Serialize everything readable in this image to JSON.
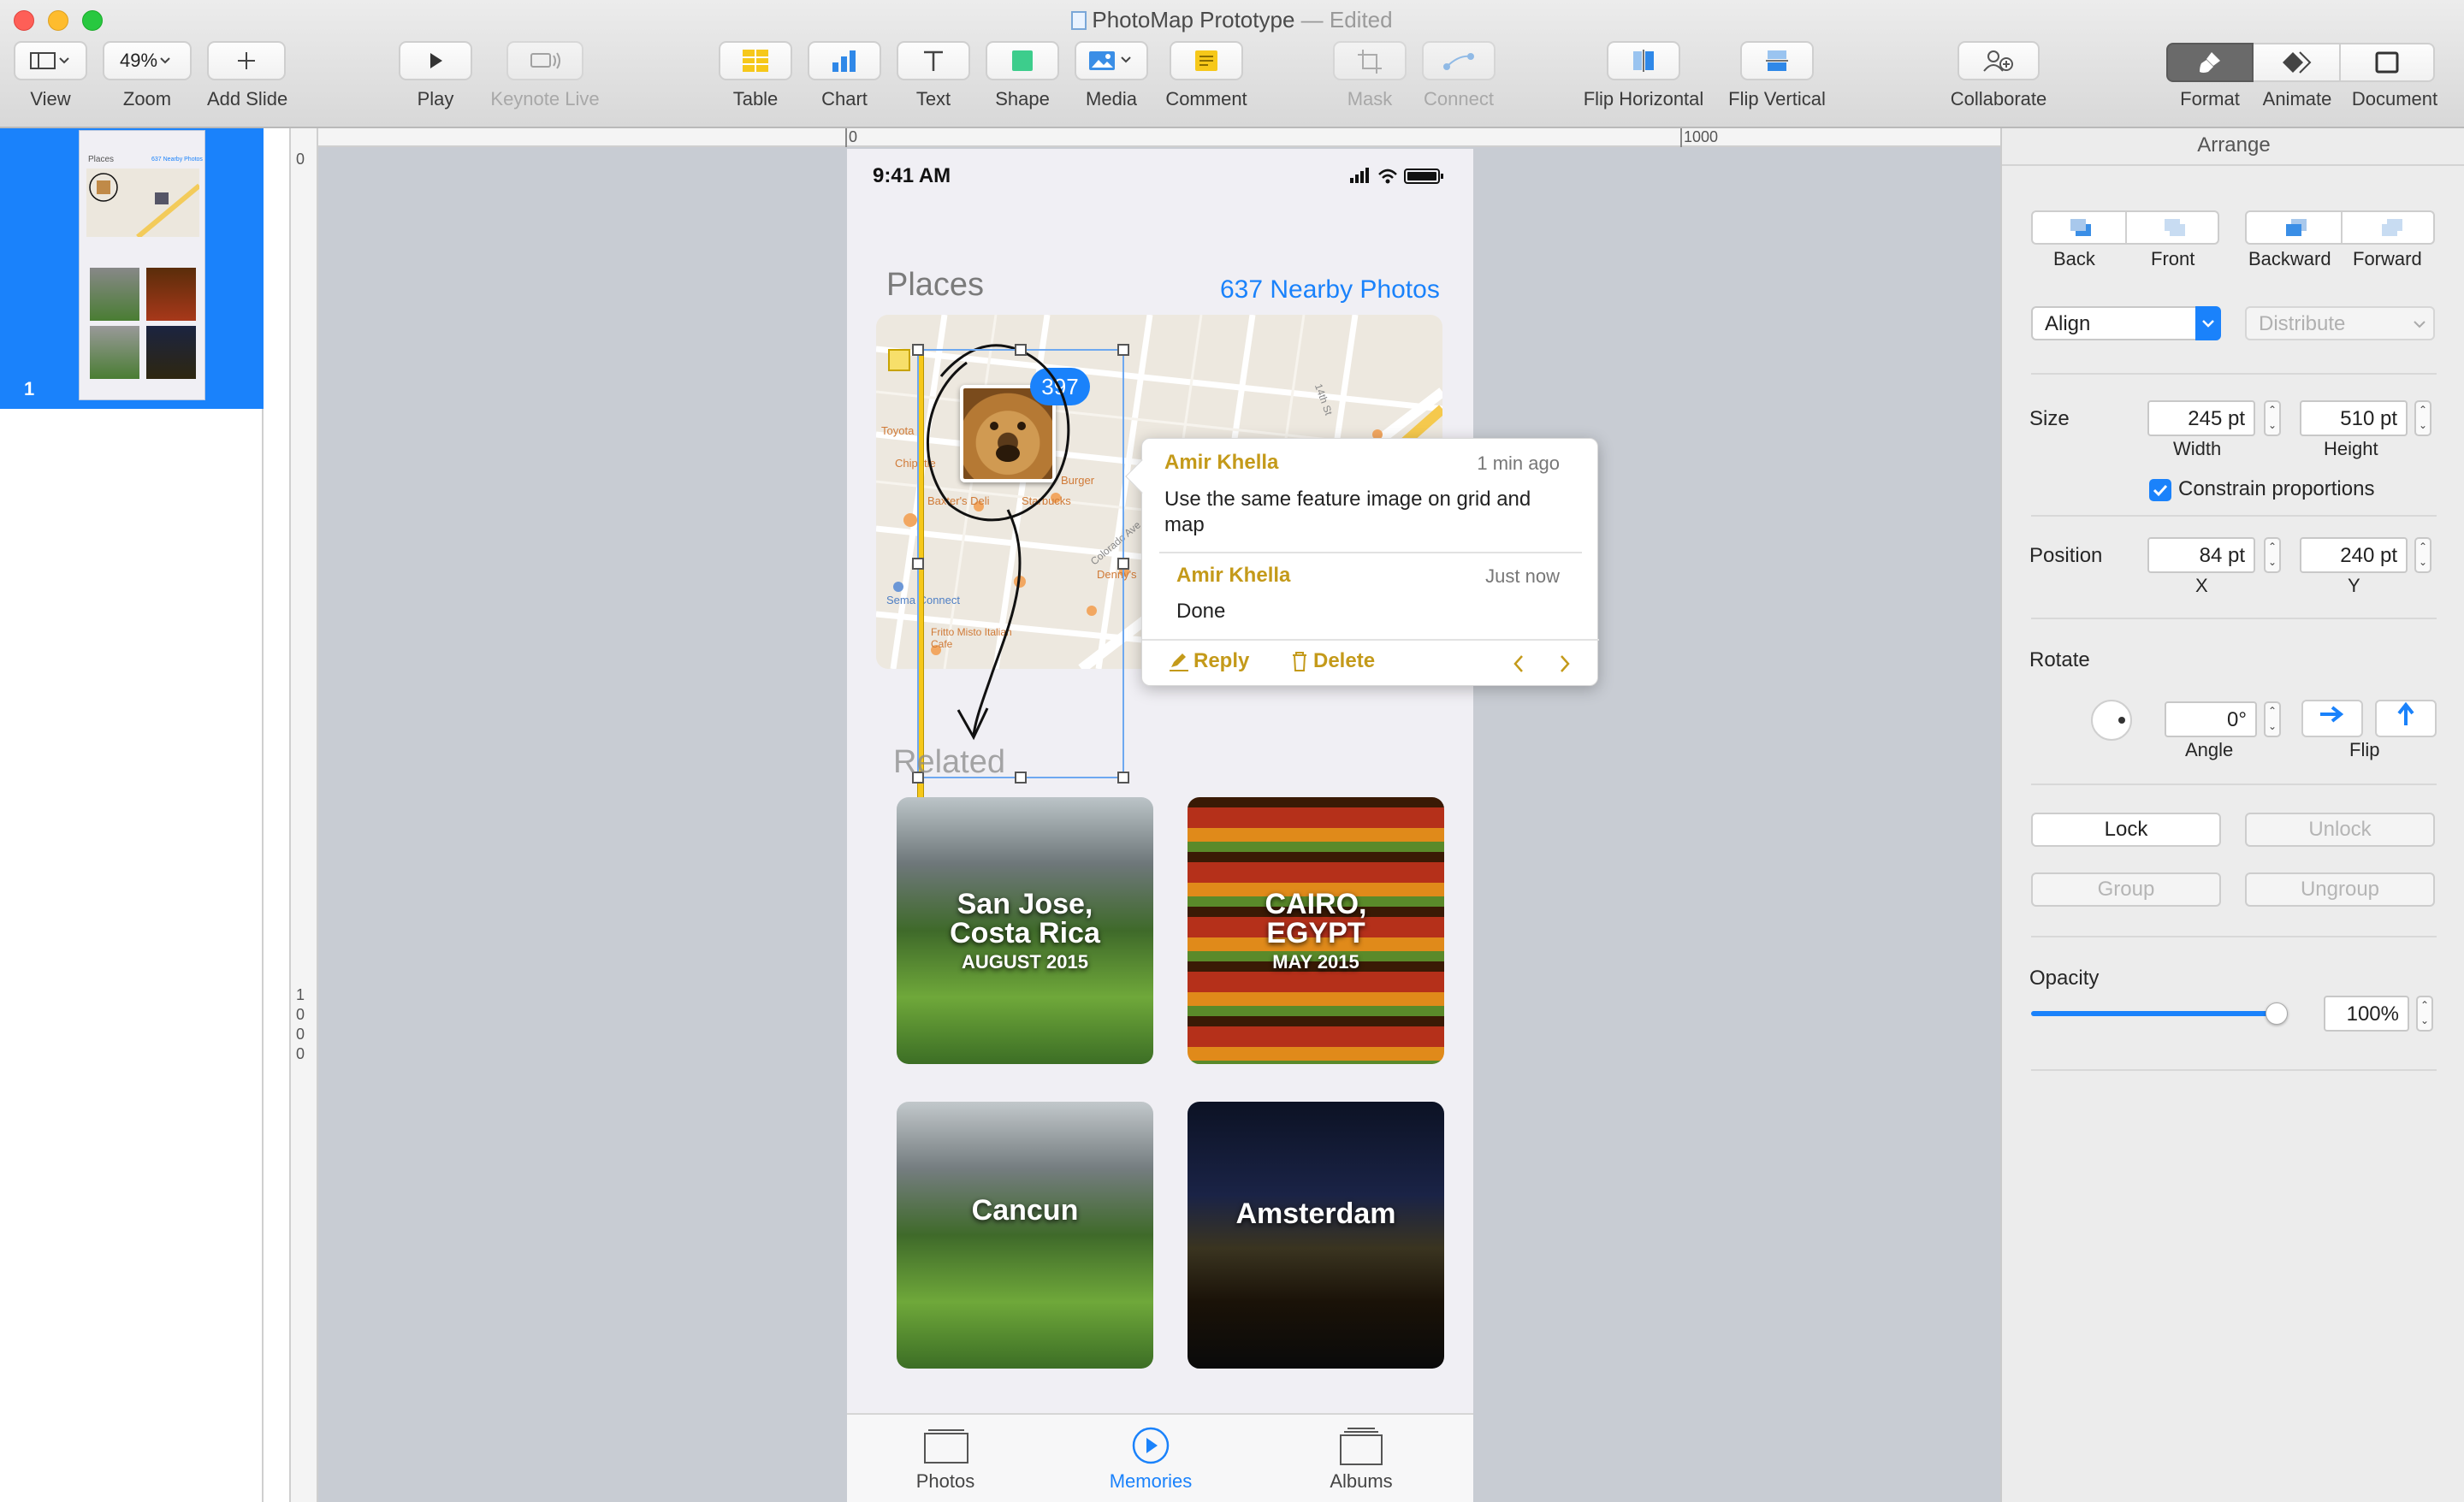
{
  "window": {
    "title": "PhotoMap Prototype",
    "edited_suffix": "— Edited"
  },
  "toolbar": {
    "view": "View",
    "zoom_value": "49%",
    "zoom": "Zoom",
    "add_slide": "Add Slide",
    "play": "Play",
    "keynote_live": "Keynote Live",
    "table": "Table",
    "chart": "Chart",
    "text": "Text",
    "shape": "Shape",
    "media": "Media",
    "comment": "Comment",
    "mask": "Mask",
    "connect": "Connect",
    "flip_horizontal": "Flip Horizontal",
    "flip_vertical": "Flip Vertical",
    "collaborate": "Collaborate",
    "format": "Format",
    "animate": "Animate",
    "document": "Document"
  },
  "sidebar": {
    "slide_number": "1"
  },
  "rulers": {
    "h_start": "0",
    "h_mark": "1000",
    "v_start": "0",
    "v_mark": [
      "1",
      "0",
      "0",
      "0"
    ]
  },
  "slide": {
    "status_time": "9:41 AM",
    "places_title": "Places",
    "nearby_link": "637 Nearby Photos",
    "badge_count": "397",
    "related_title": "Related",
    "map_labels": [
      "Toyota",
      "Chipotle",
      "Starbucks",
      "Burger",
      "Denny's",
      "Sema Connect",
      "Fritto Misto Italian Cafe",
      "Baxter's Deli",
      "Colorado Ave",
      "14th St"
    ],
    "tiles": [
      {
        "title": "San Jose,\nCosta Rica",
        "subtitle": "AUGUST 2015"
      },
      {
        "title": "CAIRO,\nEGYPT",
        "subtitle": "MAY 2015"
      },
      {
        "title": "Cancun",
        "subtitle": ""
      },
      {
        "title": "Amsterdam",
        "subtitle": ""
      }
    ],
    "tabbar": {
      "photos": "Photos",
      "memories": "Memories",
      "albums": "Albums"
    },
    "thumb_places": "Places",
    "thumb_link": "637 Nearby Photos"
  },
  "comment": {
    "author1": "Amir Khella",
    "time1": "1 min ago",
    "text1": "Use the same feature image on grid and map",
    "author2": "Amir Khella",
    "time2": "Just now",
    "text2": "Done",
    "reply": "Reply",
    "delete": "Delete"
  },
  "inspector": {
    "tab": "Arrange",
    "back": "Back",
    "front": "Front",
    "backward": "Backward",
    "forward": "Forward",
    "align": "Align",
    "distribute": "Distribute",
    "size": "Size",
    "width_value": "245 pt",
    "height_value": "510 pt",
    "width": "Width",
    "height": "Height",
    "constrain": "Constrain proportions",
    "position": "Position",
    "x_value": "84 pt",
    "y_value": "240 pt",
    "x": "X",
    "y": "Y",
    "rotate": "Rotate",
    "angle_value": "0°",
    "angle": "Angle",
    "flip": "Flip",
    "lock": "Lock",
    "unlock": "Unlock",
    "group": "Group",
    "ungroup": "Ungroup",
    "opacity": "Opacity",
    "opacity_value": "100%",
    "opacity_level": 1.0
  },
  "colors": {
    "accent": "#1a82fb",
    "comment_gold": "#c49a1a"
  }
}
